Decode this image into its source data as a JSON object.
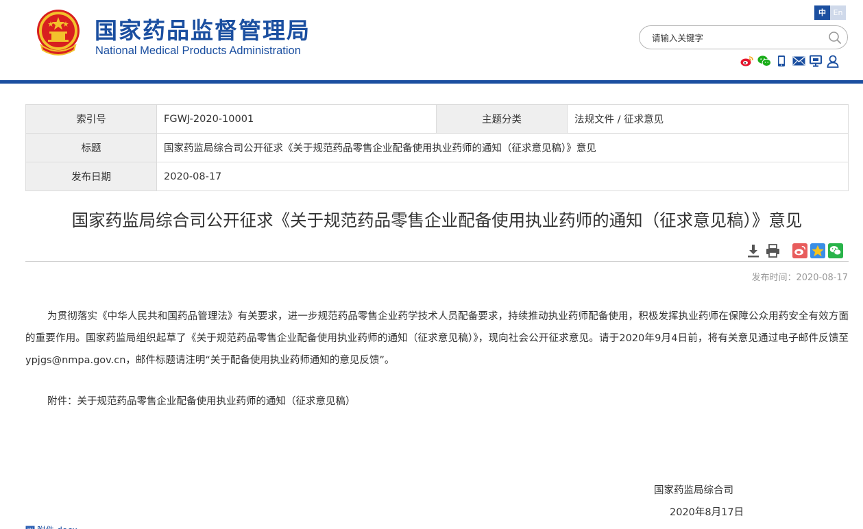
{
  "header": {
    "title_cn": "国家药品监督管理局",
    "title_en": "National Medical Products Administration",
    "lang_zh": "中",
    "lang_en": "En",
    "search_placeholder": "请输入关键字",
    "brand_color": "#1b4fa0",
    "social_icons": [
      "weibo-icon",
      "wechat-icon",
      "mobile-icon",
      "mail-icon",
      "monitor-icon",
      "user-icon"
    ]
  },
  "info_table": {
    "index_label": "索引号",
    "index_value": "FGWJ-2020-10001",
    "topic_label": "主题分类",
    "topic_value": "法规文件 / 征求意见",
    "title_label": "标题",
    "title_value": "国家药监局综合司公开征求《关于规范药品零售企业配备使用执业药师的通知（征求意见稿）》意见",
    "date_label": "发布日期",
    "date_value": "2020-08-17"
  },
  "article": {
    "title": "国家药监局综合司公开征求《关于规范药品零售企业配备使用执业药师的通知（征求意见稿）》意见",
    "publish_time": "发布时间：2020-08-17",
    "body": "为贯彻落实《中华人民共和国药品管理法》有关要求，进一步规范药品零售企业药学技术人员配备要求，持续推动执业药师配备使用，积极发挥执业药师在保障公众用药安全有效方面的重要作用。国家药监局组织起草了《关于规范药品零售企业配备使用执业药师的通知（征求意见稿）》，现向社会公开征求意见。请于2020年9月4日前，将有关意见通过电子邮件反馈至ypjgs@nmpa.gov.cn，邮件标题请注明“关于配备使用执业药师通知的意见反馈”。",
    "attachment": "附件：关于规范药品零售企业配备使用执业药师的通知（征求意见稿）",
    "signature_org": "国家药监局综合司",
    "signature_date": "2020年8月17日",
    "file_link": "附件.docx"
  },
  "tools": [
    "download-icon",
    "print-icon",
    "share-weibo-icon",
    "share-qzone-icon",
    "share-wechat-icon"
  ]
}
